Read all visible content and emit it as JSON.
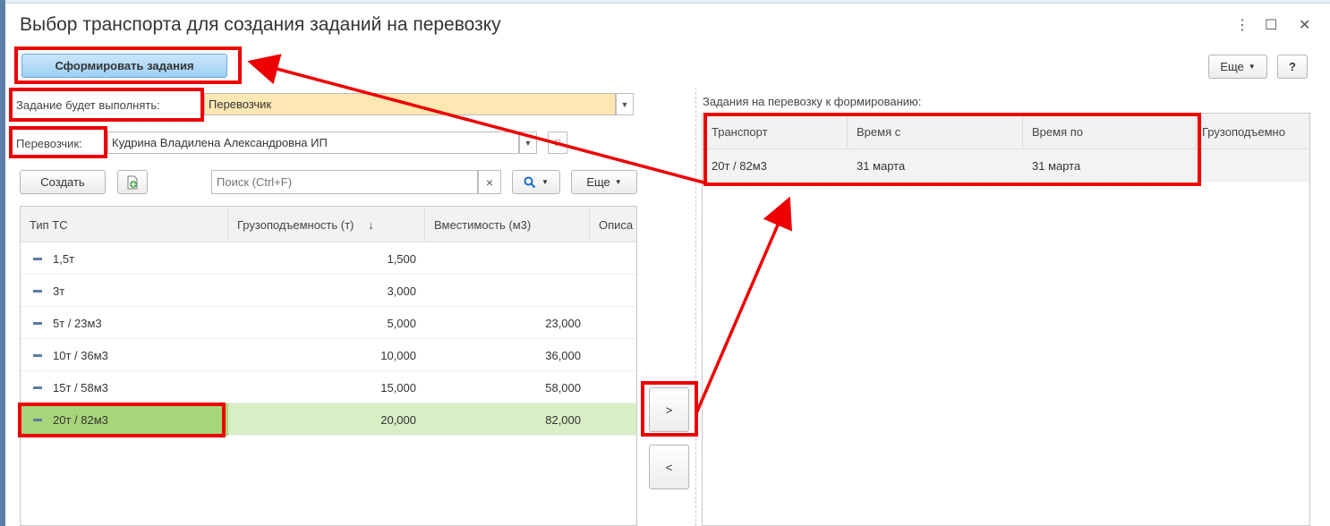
{
  "window": {
    "title": "Выбор транспорта для создания заданий на перевозку",
    "controls": {
      "menu_icon": "⋮",
      "maximize_icon": "☐",
      "close_icon": "✕"
    }
  },
  "toolbar": {
    "create_tasks_label": "Сформировать задания",
    "more_label": "Еще",
    "help_label": "?"
  },
  "form": {
    "executor_label": "Задание будет выполнять:",
    "executor_value": "Перевозчик",
    "carrier_label": "Перевозчик:",
    "carrier_value": "Кудрина Владилена Александровна ИП"
  },
  "left_panel": {
    "create_label": "Создать",
    "search_placeholder": "Поиск (Ctrl+F)",
    "clear_icon": "×",
    "search_icon": "search-icon",
    "more_label": "Еще",
    "columns": [
      "Тип ТС",
      "Грузоподъемность (т)",
      "Вместимость (м3)",
      "Описа"
    ],
    "sort_indicator": "↓",
    "rows": [
      {
        "type": "1,5т",
        "capacity": "1,500",
        "volume": ""
      },
      {
        "type": "3т",
        "capacity": "3,000",
        "volume": ""
      },
      {
        "type": "5т / 23м3",
        "capacity": "5,000",
        "volume": "23,000"
      },
      {
        "type": "10т / 36м3",
        "capacity": "10,000",
        "volume": "36,000"
      },
      {
        "type": "15т / 58м3",
        "capacity": "15,000",
        "volume": "58,000"
      },
      {
        "type": "20т / 82м3",
        "capacity": "20,000",
        "volume": "82,000",
        "selected": true
      }
    ]
  },
  "transfer": {
    "add_label": ">",
    "remove_label": "<"
  },
  "right_panel": {
    "caption": "Задания на перевозку к формированию:",
    "columns": [
      "Транспорт",
      "Время с",
      "Время по",
      "Грузоподъемно"
    ],
    "rows": [
      {
        "transport": "20т / 82м3",
        "time_from": "31 марта",
        "time_to": "31 марта"
      }
    ]
  },
  "colors": {
    "highlight": "#ee0000",
    "selected_row": "#d8eec4",
    "primary_button": "#9fd0f5",
    "yellow_field": "#fde7b2"
  }
}
